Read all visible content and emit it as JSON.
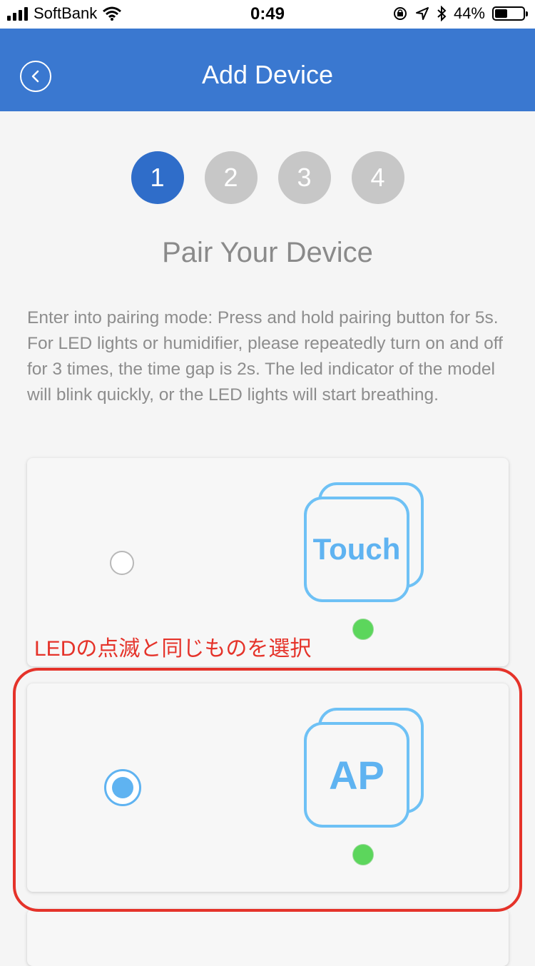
{
  "status_bar": {
    "carrier": "SoftBank",
    "time": "0:49",
    "battery": "44%",
    "battery_level": 0.44
  },
  "nav": {
    "title": "Add Device"
  },
  "steps": [
    "1",
    "2",
    "3",
    "4"
  ],
  "active_step": 1,
  "page_title": "Pair Your Device",
  "description": "Enter into pairing mode: Press and hold pairing button for 5s. For LED lights or humidifier, please repeatedly turn on and off for 3 times, the time gap is 2s. The led indicator of the model will blink quickly, or the LED lights will start breathing.",
  "modes": [
    {
      "label": "Touch",
      "selected": false
    },
    {
      "label": "AP",
      "selected": true
    }
  ],
  "annotation": "LEDの点滅と同じものを選択",
  "colors": {
    "nav_bg": "#3a78d0",
    "active_step": "#2f6dc9",
    "inactive_step": "#c7c7c7",
    "icon_blue": "#5fb3f1",
    "led_green": "#5cd65c",
    "annotation_red": "#e5332a"
  }
}
